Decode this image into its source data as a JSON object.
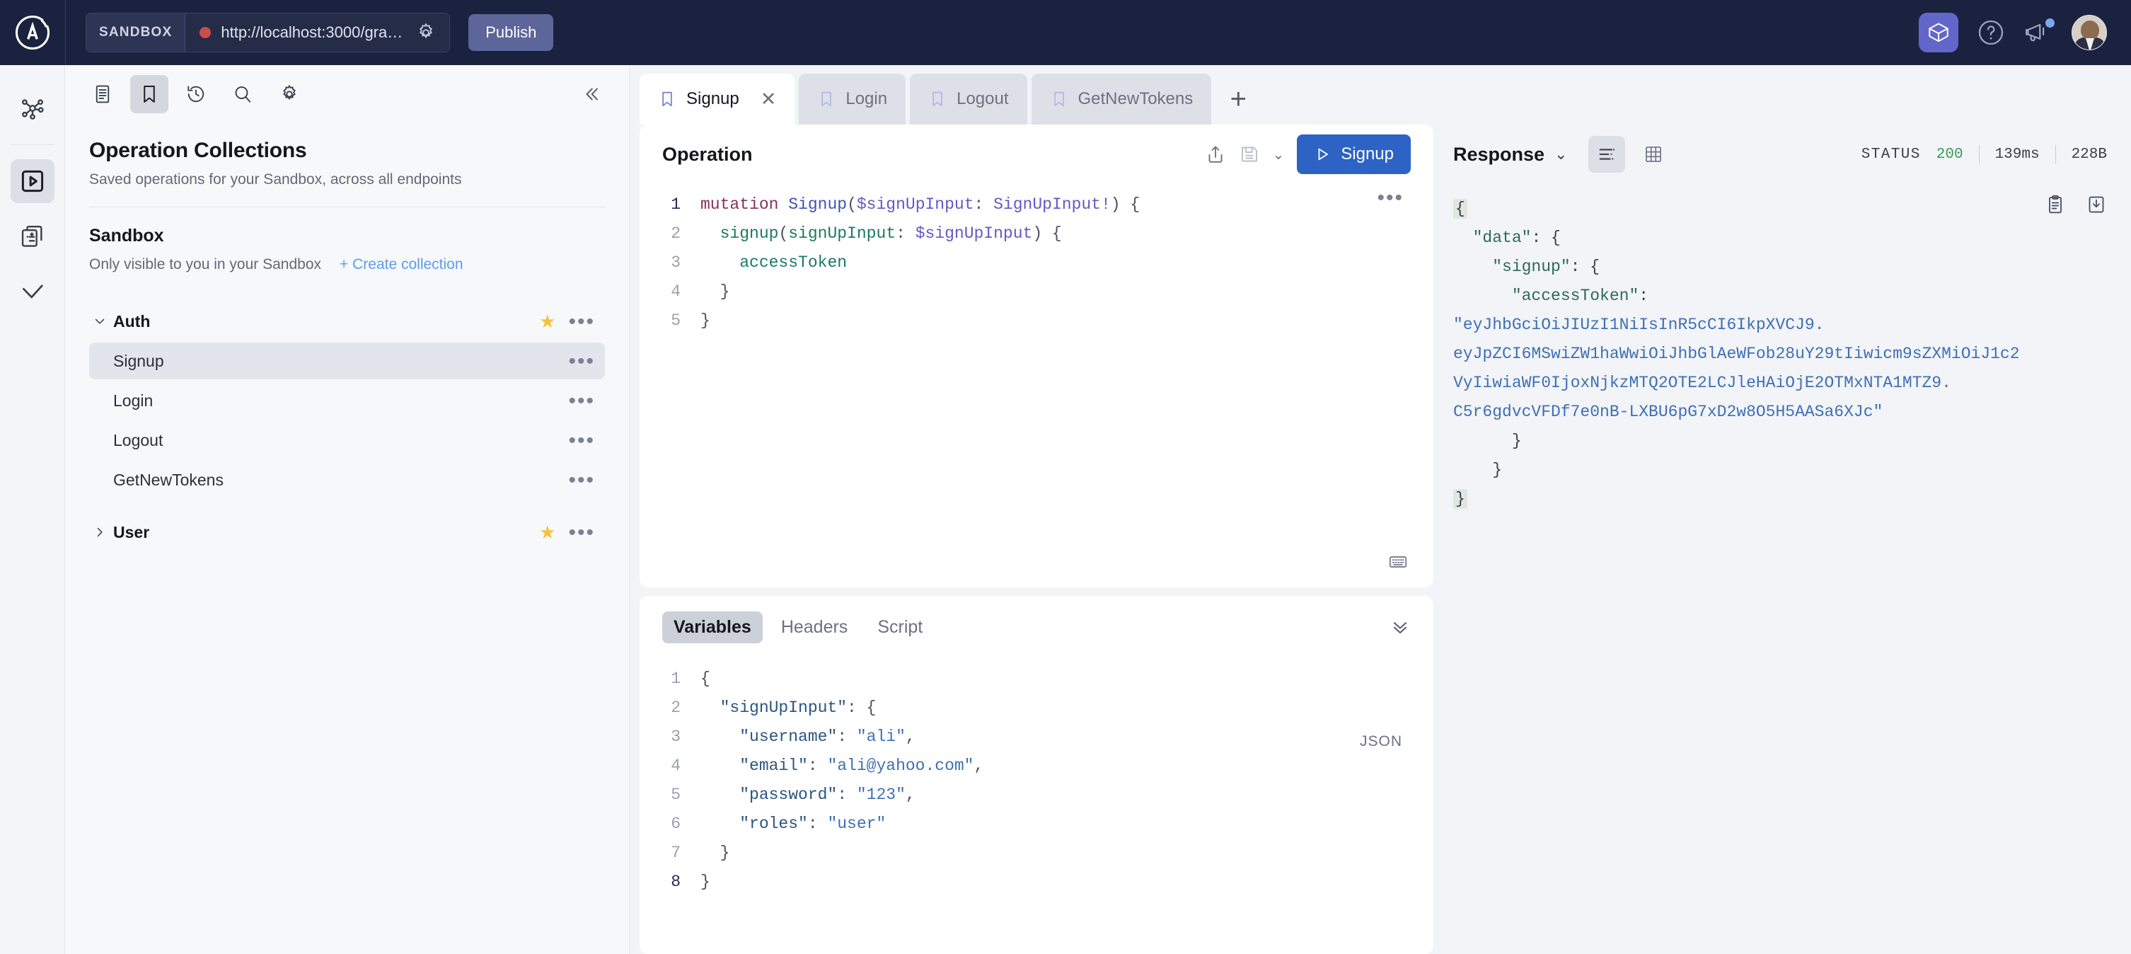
{
  "topbar": {
    "logo_icon": "apollo-logo-icon",
    "sandbox_chip": "SANDBOX",
    "url": "http://localhost:3000/gra…",
    "url_settings_icon": "gear-icon",
    "connection_status_icon": "status-dot-icon",
    "publish_label": "Publish",
    "sandbox_box_icon": "sandbox-cube-icon",
    "help_icon": "help-circle-icon",
    "announcements_icon": "megaphone-icon",
    "avatar_icon": "user-avatar"
  },
  "rail": {
    "items": [
      {
        "name": "schema-graph-icon",
        "label": "Graph"
      },
      {
        "name": "explorer-play-icon",
        "label": "Explorer",
        "active": true
      },
      {
        "name": "schema-diff-icon",
        "label": "Schema Diff"
      },
      {
        "name": "checks-check-icon",
        "label": "Checks"
      }
    ]
  },
  "collections": {
    "toolbar": [
      {
        "name": "documentation-icon",
        "active": false
      },
      {
        "name": "bookmark-icon",
        "active": true
      },
      {
        "name": "history-icon",
        "active": false
      },
      {
        "name": "search-icon",
        "active": false
      },
      {
        "name": "settings-gear-icon",
        "active": false
      }
    ],
    "collapse_icon": "collapse-left-icon",
    "title": "Operation Collections",
    "subtitle": "Saved operations for your Sandbox, across all endpoints",
    "section_title": "Sandbox",
    "section_note": "Only visible to you in your Sandbox",
    "create_collection_label": "+ Create collection",
    "groups": [
      {
        "label": "Auth",
        "expanded": true,
        "caret": "chevron-down-icon",
        "starred": true,
        "items": [
          {
            "label": "Signup",
            "selected": true
          },
          {
            "label": "Login",
            "selected": false
          },
          {
            "label": "Logout",
            "selected": false
          },
          {
            "label": "GetNewTokens",
            "selected": false
          }
        ]
      },
      {
        "label": "User",
        "expanded": false,
        "caret": "chevron-right-icon",
        "starred": true,
        "items": []
      }
    ]
  },
  "tabs": {
    "items": [
      {
        "label": "Signup",
        "active": true,
        "closable": true
      },
      {
        "label": "Login",
        "active": false,
        "closable": false
      },
      {
        "label": "Logout",
        "active": false,
        "closable": false
      },
      {
        "label": "GetNewTokens",
        "active": false,
        "closable": false
      }
    ],
    "add_label": "+"
  },
  "operation": {
    "title": "Operation",
    "share_icon": "share-upload-icon",
    "save_icon": "save-floppy-icon",
    "save_dropdown_icon": "chevron-down-icon",
    "run_label": "Signup",
    "run_icon": "play-icon",
    "more_icon": "more-horizontal-icon",
    "keyboard_icon": "keyboard-shortcuts-icon",
    "lines": [
      {
        "n": "1",
        "highlight": true,
        "tokens": [
          {
            "t": "mutation ",
            "c": "tok-kw"
          },
          {
            "t": "Signup",
            "c": "tok-opname"
          },
          {
            "t": "(",
            "c": "tok-punc"
          },
          {
            "t": "$signUpInput",
            "c": "tok-var"
          },
          {
            "t": ": ",
            "c": "tok-punc"
          },
          {
            "t": "SignUpInput!",
            "c": "tok-type"
          },
          {
            "t": ") {",
            "c": "tok-punc"
          }
        ]
      },
      {
        "n": "2",
        "highlight": false,
        "tokens": [
          {
            "t": "  ",
            "c": "tok-punc"
          },
          {
            "t": "signup",
            "c": "tok-field"
          },
          {
            "t": "(",
            "c": "tok-punc"
          },
          {
            "t": "signUpInput",
            "c": "tok-arg"
          },
          {
            "t": ": ",
            "c": "tok-punc"
          },
          {
            "t": "$signUpInput",
            "c": "tok-var"
          },
          {
            "t": ") {",
            "c": "tok-punc"
          }
        ]
      },
      {
        "n": "3",
        "highlight": false,
        "tokens": [
          {
            "t": "    ",
            "c": "tok-punc"
          },
          {
            "t": "accessToken",
            "c": "tok-field"
          }
        ]
      },
      {
        "n": "4",
        "highlight": false,
        "tokens": [
          {
            "t": "  }",
            "c": "tok-punc"
          }
        ]
      },
      {
        "n": "5",
        "highlight": false,
        "tokens": [
          {
            "t": "}",
            "c": "tok-punc"
          }
        ]
      }
    ]
  },
  "variables": {
    "tabs": [
      {
        "label": "Variables",
        "active": true
      },
      {
        "label": "Headers",
        "active": false
      },
      {
        "label": "Script",
        "active": false
      }
    ],
    "collapse_icon": "chevron-double-down-icon",
    "format_badge": "JSON",
    "lines": [
      {
        "n": "1",
        "highlight": false,
        "tokens": [
          {
            "t": "{",
            "c": "jpunc"
          }
        ]
      },
      {
        "n": "2",
        "highlight": false,
        "tokens": [
          {
            "t": "  ",
            "c": "jpunc"
          },
          {
            "t": "\"signUpInput\"",
            "c": "jkey"
          },
          {
            "t": ": {",
            "c": "jpunc"
          }
        ]
      },
      {
        "n": "3",
        "highlight": false,
        "tokens": [
          {
            "t": "    ",
            "c": "jpunc"
          },
          {
            "t": "\"username\"",
            "c": "jkey"
          },
          {
            "t": ": ",
            "c": "jpunc"
          },
          {
            "t": "\"ali\"",
            "c": "jstr"
          },
          {
            "t": ",",
            "c": "jpunc"
          }
        ]
      },
      {
        "n": "4",
        "highlight": false,
        "tokens": [
          {
            "t": "    ",
            "c": "jpunc"
          },
          {
            "t": "\"email\"",
            "c": "jkey"
          },
          {
            "t": ": ",
            "c": "jpunc"
          },
          {
            "t": "\"ali@yahoo.com\"",
            "c": "jstr"
          },
          {
            "t": ",",
            "c": "jpunc"
          }
        ]
      },
      {
        "n": "5",
        "highlight": false,
        "tokens": [
          {
            "t": "    ",
            "c": "jpunc"
          },
          {
            "t": "\"password\"",
            "c": "jkey"
          },
          {
            "t": ": ",
            "c": "jpunc"
          },
          {
            "t": "\"123\"",
            "c": "jstr"
          },
          {
            "t": ",",
            "c": "jpunc"
          }
        ]
      },
      {
        "n": "6",
        "highlight": false,
        "tokens": [
          {
            "t": "    ",
            "c": "jpunc"
          },
          {
            "t": "\"roles\"",
            "c": "jkey"
          },
          {
            "t": ": ",
            "c": "jpunc"
          },
          {
            "t": "\"user\"",
            "c": "jstr"
          }
        ]
      },
      {
        "n": "7",
        "highlight": false,
        "tokens": [
          {
            "t": "  }",
            "c": "jpunc"
          }
        ]
      },
      {
        "n": "8",
        "highlight": true,
        "tokens": [
          {
            "t": "}",
            "c": "jpunc"
          }
        ]
      }
    ]
  },
  "response": {
    "title": "Response",
    "dropdown_icon": "chevron-down-icon",
    "view_json_icon": "json-view-icon",
    "view_table_icon": "table-view-icon",
    "status_label": "STATUS",
    "status_code": "200",
    "time": "139ms",
    "size": "228B",
    "copy_icon": "clipboard-copy-icon",
    "download_icon": "download-icon",
    "body_lines": [
      {
        "type": "brace-open",
        "text": "{"
      },
      {
        "type": "key",
        "indent": "  ",
        "key": "\"data\"",
        "after": ": {"
      },
      {
        "type": "key",
        "indent": "    ",
        "key": "\"signup\"",
        "after": ": {"
      },
      {
        "type": "key",
        "indent": "      ",
        "key": "\"accessToken\"",
        "after": ":"
      },
      {
        "type": "jwt",
        "text": "\"eyJhbGciOiJIUzI1NiIsInR5cCI6IkpXVCJ9."
      },
      {
        "type": "jwt",
        "text": "eyJpZCI6MSwiZW1haWwiOiJhbGlAeWFob28uY29tIiwicm9sZXMiOiJ1c2"
      },
      {
        "type": "jwt",
        "text": "VyIiwiaWF0IjoxNjkzMTQ2OTE2LCJleHAiOjE2OTMxNTA1MTZ9."
      },
      {
        "type": "jwt",
        "text": "C5r6gdvcVFDf7e0nB-LXBU6pG7xD2w8O5H5AASa6XJc\""
      },
      {
        "type": "plain",
        "text": "      }"
      },
      {
        "type": "plain",
        "text": "    }"
      },
      {
        "type": "brace-close",
        "text": "}"
      }
    ]
  }
}
